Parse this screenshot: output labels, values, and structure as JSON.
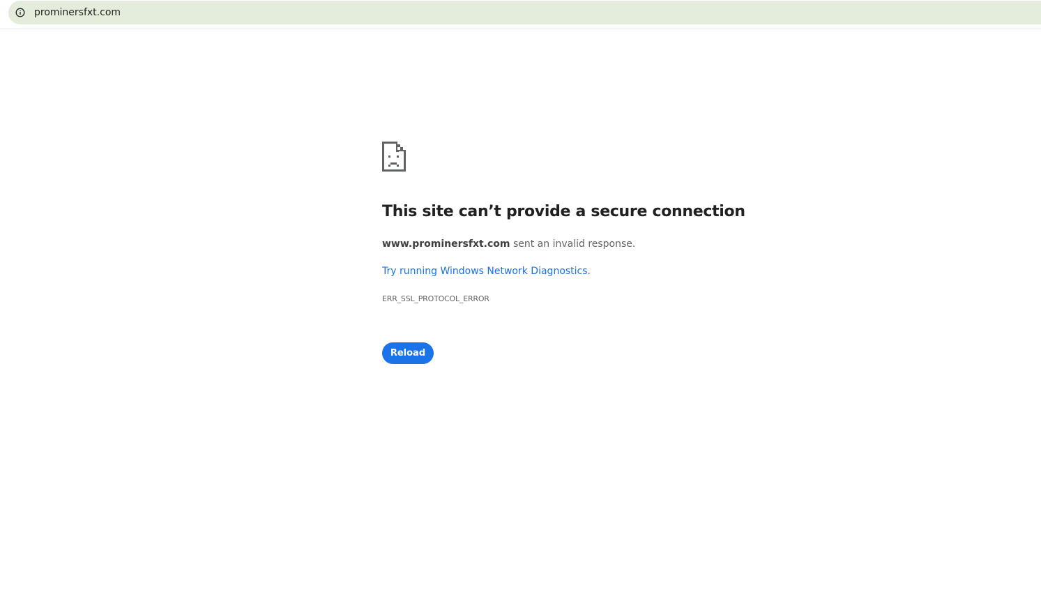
{
  "browser": {
    "address_bar": {
      "url": "prominersfxt.com",
      "site_info_icon": "info-icon"
    }
  },
  "error_page": {
    "icon": "sad-document-icon",
    "title": "This site can’t provide a secure connection",
    "summary": {
      "host": "www.prominersfxt.com",
      "message": " sent an invalid response."
    },
    "suggestion": {
      "link_text": "Try running Windows Network Diagnostics",
      "suffix": "."
    },
    "error_code": "ERR_SSL_PROTOCOL_ERROR",
    "reload_label": "Reload"
  },
  "colors": {
    "accent": "#1a73e8",
    "omnibox_bg": "#e4ecdc",
    "heading_text": "#202124",
    "body_text": "#5f6368"
  }
}
